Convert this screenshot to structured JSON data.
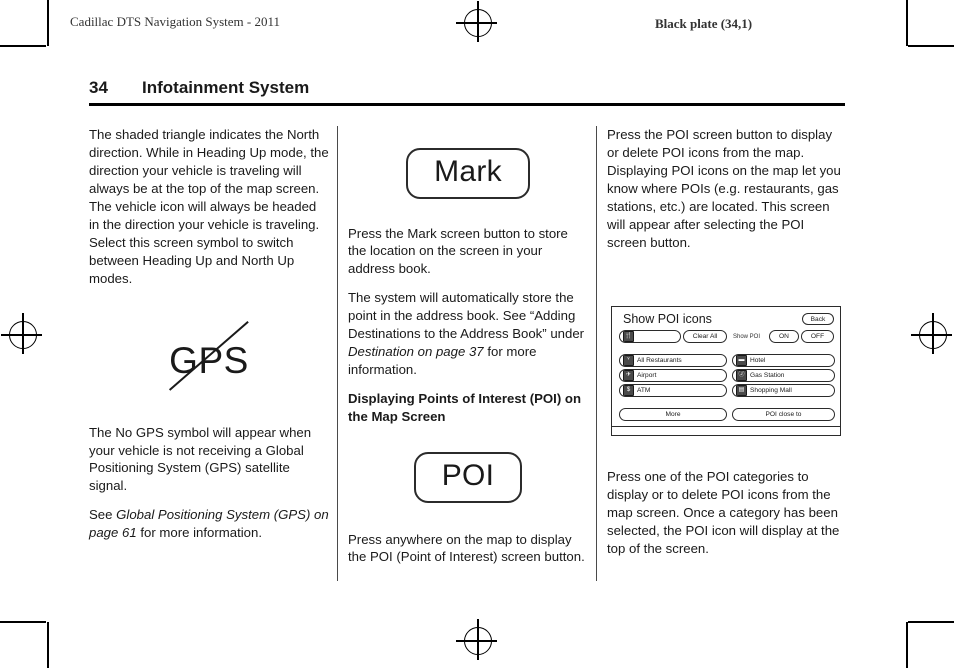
{
  "running_head": {
    "book_title": "Cadillac DTS Navigation System - 2011",
    "plate_info": "Black plate (34,1)"
  },
  "page_header": {
    "page_number": "34",
    "section_title": "Infotainment System"
  },
  "column_1": {
    "para_1": "The shaded triangle indicates the North direction. While in Heading Up mode, the direction your vehicle is traveling will always be at the top of the map screen. The vehicle icon will always be headed in the direction your vehicle is traveling. Select this screen symbol to switch between Heading Up and North Up modes.",
    "gps_symbol_label": "GPS",
    "para_2": "The No GPS symbol will appear when your vehicle is not receiving a Global Positioning System (GPS) satellite signal.",
    "para_3_prefix": "See ",
    "para_3_italic": "Global Positioning System (GPS) on page 61",
    "para_3_suffix": " for more information."
  },
  "column_2": {
    "mark_button_label": "Mark",
    "para_1": "Press the Mark screen button to store the location on the screen in your address book.",
    "para_2_part1": "The system will automatically store the point in the address book. See “Adding Destinations to the Address Book” under ",
    "para_2_italic": "Destination on page 37",
    "para_2_part2": " for more information.",
    "sub_head": "Displaying Points of Interest (POI) on the Map Screen",
    "poi_button_label": "POI",
    "para_3": "Press anywhere on the map to display the POI (Point of Interest) screen button."
  },
  "column_3": {
    "para_1": "Press the POI screen button to display or delete POI icons from the map. Displaying POI icons on the map let you know where POIs (e.g. restaurants, gas stations, etc.) are located. This screen will appear after selecting the POI screen button.",
    "para_2": "Press one of the POI categories to display or to delete POI icons from the map screen. Once a category has been selected, the POI icon will display at the top of the screen."
  },
  "poi_screen": {
    "title": "Show POI icons",
    "selected_icon_field": "",
    "selected_icon_glyph": "🍴",
    "clear_all_label": "Clear All",
    "show_poi_label": "Show POI",
    "on_label": "ON",
    "off_label": "OFF",
    "back_label": "Back",
    "categories_left": [
      {
        "label": "All Restaurants",
        "icon": "restaurant-icon",
        "glyph": "ᵛ"
      },
      {
        "label": "Airport",
        "icon": "airport-icon",
        "glyph": "✈"
      },
      {
        "label": "ATM",
        "icon": "atm-icon",
        "glyph": "$"
      }
    ],
    "categories_right": [
      {
        "label": "Hotel",
        "icon": "hotel-icon",
        "glyph": "▬"
      },
      {
        "label": "Gas Station",
        "icon": "gas-station-icon",
        "glyph": "Ⓙ"
      },
      {
        "label": "Shopping Mall",
        "icon": "shopping-mall-icon",
        "glyph": "▤"
      }
    ],
    "more_label": "More",
    "poi_close_to_label": "POI close to"
  },
  "colors": {
    "ink": "#1a1a1a",
    "rule": "#4a4a4a",
    "page": "#ffffff"
  }
}
